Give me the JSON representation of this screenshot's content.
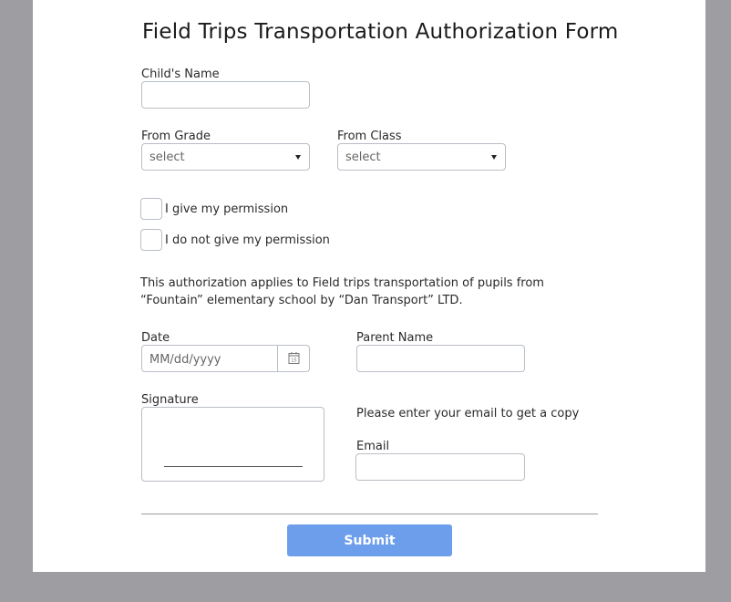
{
  "form": {
    "title": "Field Trips Transportation Authorization Form",
    "child_name": {
      "label": "Child's Name",
      "value": ""
    },
    "from_grade": {
      "label": "From Grade",
      "selected": "select"
    },
    "from_class": {
      "label": "From Class",
      "selected": "select"
    },
    "permission": {
      "give": "I give my permission",
      "deny": "I do not give my permission"
    },
    "authorization_text": "This authorization applies to Field trips transportation of pupils from “Fountain” elementary school by “Dan Transport” LTD.",
    "date": {
      "label": "Date",
      "placeholder": "MM/dd/yyyy",
      "icon": "calendar-icon"
    },
    "parent_name": {
      "label": "Parent Name",
      "value": ""
    },
    "signature": {
      "label": "Signature"
    },
    "email_note": "Please enter your email to get a copy",
    "email": {
      "label": "Email",
      "value": ""
    },
    "submit_label": "Submit"
  },
  "colors": {
    "page_background": "#9e9ea2",
    "card_background": "#ffffff",
    "submit_button": "#6d9eeb",
    "field_border": "#b9bec5"
  }
}
